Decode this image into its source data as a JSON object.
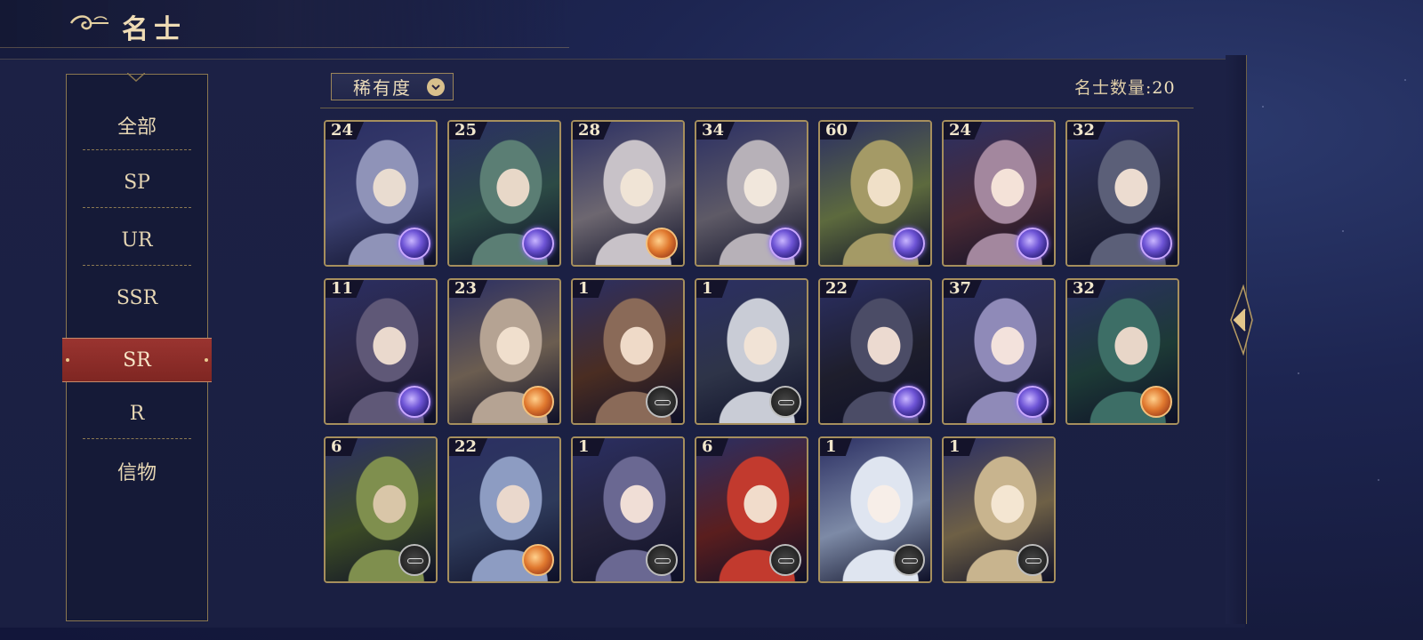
{
  "header": {
    "title": "名士"
  },
  "sidebar": {
    "items": [
      {
        "label": "全部",
        "active": false
      },
      {
        "label": "SP",
        "active": false
      },
      {
        "label": "UR",
        "active": false
      },
      {
        "label": "SSR",
        "active": false
      },
      {
        "label": "SR",
        "active": true
      },
      {
        "label": "R",
        "active": false
      },
      {
        "label": "信物",
        "active": false
      }
    ]
  },
  "toolbar": {
    "sort_label": "稀有度",
    "count_label": "名士数量:",
    "count_value": "20"
  },
  "colors": {
    "accent_gold": "#a68f5d",
    "active_red": "#8a2e2a",
    "notify_red": "#e0302a"
  },
  "cards": [
    {
      "level": "24",
      "badge": "purple",
      "palette": [
        "#3a3f6e",
        "#8f93b8",
        "#e9dcd0"
      ],
      "notify": false
    },
    {
      "level": "25",
      "badge": "purple",
      "palette": [
        "#2c4a45",
        "#5b7e74",
        "#e8d8c8"
      ],
      "notify": false
    },
    {
      "level": "28",
      "badge": "orange",
      "palette": [
        "#6d6770",
        "#c8c2c8",
        "#f0e4d6"
      ],
      "notify": false
    },
    {
      "level": "34",
      "badge": "purple",
      "palette": [
        "#5e5a66",
        "#b7b1b8",
        "#f1e7dc"
      ],
      "notify": false
    },
    {
      "level": "60",
      "badge": "purple",
      "palette": [
        "#5d6a3e",
        "#a49a66",
        "#f0e0c8"
      ],
      "notify": false
    },
    {
      "level": "24",
      "badge": "purple",
      "palette": [
        "#4a2a34",
        "#a3879e",
        "#f4e2d8"
      ],
      "notify": false
    },
    {
      "level": "32",
      "badge": "purple",
      "palette": [
        "#22243a",
        "#5b5f78",
        "#ecdcd0"
      ],
      "notify": false
    },
    {
      "level": "11",
      "badge": "purple",
      "palette": [
        "#2a2440",
        "#5f5877",
        "#ead9cd"
      ],
      "notify": false
    },
    {
      "level": "23",
      "badge": "orange",
      "palette": [
        "#6b5d50",
        "#b5a393",
        "#f0dfcd"
      ],
      "notify": false
    },
    {
      "level": "1",
      "badge": "dark",
      "palette": [
        "#4a2d22",
        "#8a6a58",
        "#efdac8"
      ],
      "notify": false
    },
    {
      "level": "1",
      "badge": "dark",
      "palette": [
        "#2e3448",
        "#c9ccd6",
        "#f1e3d6"
      ],
      "notify": false
    },
    {
      "level": "22",
      "badge": "purple",
      "palette": [
        "#1e1e2c",
        "#4b4c66",
        "#ecdad0"
      ],
      "notify": false
    },
    {
      "level": "37",
      "badge": "purple",
      "palette": [
        "#2a2a46",
        "#8f8ab8",
        "#f3e2dc"
      ],
      "notify": false
    },
    {
      "level": "32",
      "badge": "orange",
      "palette": [
        "#1d3a36",
        "#3d6e66",
        "#e8d6c8"
      ],
      "notify": true
    },
    {
      "level": "6",
      "badge": "dark",
      "palette": [
        "#3b4a26",
        "#7f8f4e",
        "#d9c6a8"
      ],
      "notify": false
    },
    {
      "level": "22",
      "badge": "orange",
      "palette": [
        "#2e3a5a",
        "#8d9cc2",
        "#ead8cc"
      ],
      "notify": true
    },
    {
      "level": "1",
      "badge": "dark",
      "palette": [
        "#24223a",
        "#6a6892",
        "#f0ded6"
      ],
      "notify": false
    },
    {
      "level": "6",
      "badge": "dark",
      "palette": [
        "#5a1e1e",
        "#c23a2e",
        "#f1dccb"
      ],
      "notify": false
    },
    {
      "level": "1",
      "badge": "dark",
      "palette": [
        "#7d8aa6",
        "#dfe5f0",
        "#f7eee8"
      ],
      "notify": false
    },
    {
      "level": "1",
      "badge": "dark",
      "palette": [
        "#6e6046",
        "#c8b48e",
        "#f4e6d2"
      ],
      "notify": false
    }
  ]
}
